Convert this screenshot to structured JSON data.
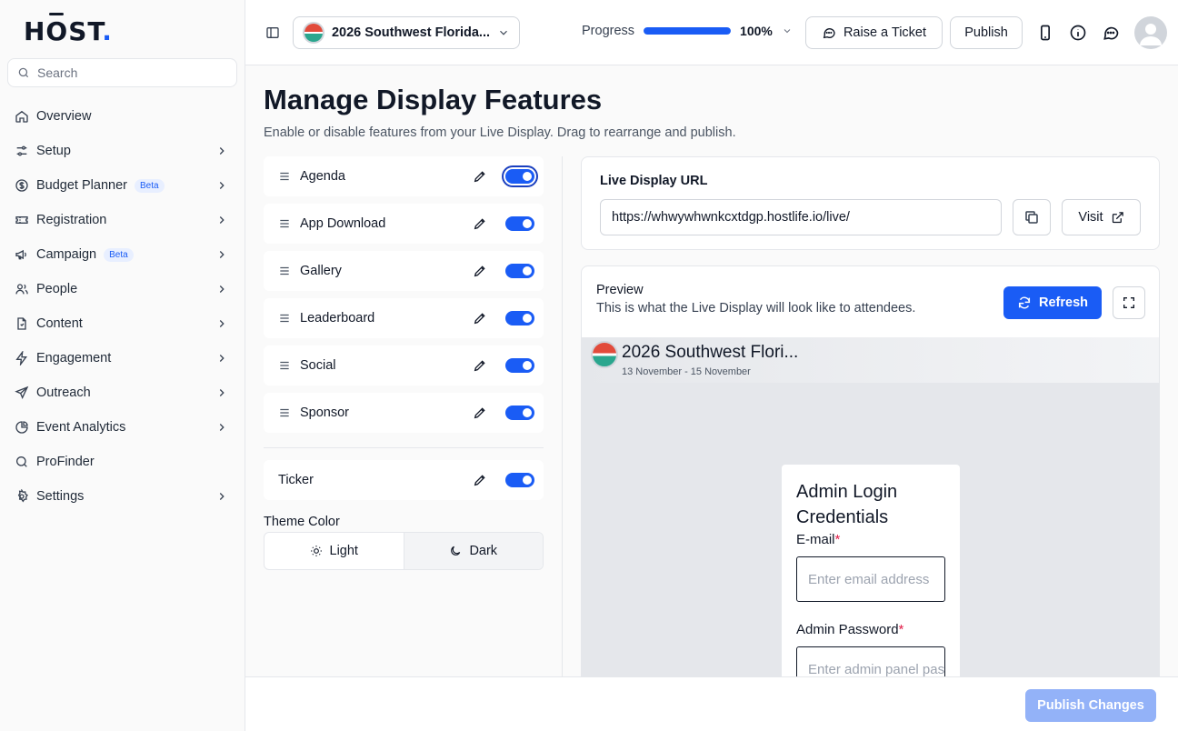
{
  "brand": {
    "logo_text": "HOST",
    "logo_dot": "."
  },
  "sidebar": {
    "search_placeholder": "Search",
    "items": [
      {
        "label": "Overview",
        "icon": "home-icon",
        "chevron": false,
        "badge": ""
      },
      {
        "label": "Setup",
        "icon": "sliders-icon",
        "chevron": true,
        "badge": ""
      },
      {
        "label": "Budget Planner",
        "icon": "dollar-icon",
        "chevron": true,
        "badge": "Beta"
      },
      {
        "label": "Registration",
        "icon": "ticket-icon",
        "chevron": true,
        "badge": ""
      },
      {
        "label": "Campaign",
        "icon": "megaphone-icon",
        "chevron": true,
        "badge": "Beta"
      },
      {
        "label": "People",
        "icon": "users-icon",
        "chevron": true,
        "badge": ""
      },
      {
        "label": "Content",
        "icon": "file-icon",
        "chevron": true,
        "badge": ""
      },
      {
        "label": "Engagement",
        "icon": "bolt-icon",
        "chevron": true,
        "badge": ""
      },
      {
        "label": "Outreach",
        "icon": "send-icon",
        "chevron": true,
        "badge": ""
      },
      {
        "label": "Event Analytics",
        "icon": "pie-chart-icon",
        "chevron": true,
        "badge": ""
      },
      {
        "label": "ProFinder",
        "icon": "search-icon",
        "chevron": false,
        "badge": ""
      },
      {
        "label": "Settings",
        "icon": "gear-icon",
        "chevron": true,
        "badge": ""
      }
    ]
  },
  "topbar": {
    "event_name": "2026 Southwest Florida...",
    "progress_label": "Progress",
    "progress_value": "100%",
    "progress_fraction": 1.0,
    "raise_ticket": "Raise a Ticket",
    "publish": "Publish"
  },
  "main": {
    "title": "Manage Display Features",
    "subtitle": "Enable or disable features from your Live Display. Drag to rearrange and publish.",
    "features": [
      "Agenda",
      "App Download",
      "Gallery",
      "Leaderboard",
      "Social",
      "Sponsor"
    ],
    "ticker": "Ticker",
    "theme_label": "Theme Color",
    "theme_light": "Light",
    "theme_dark": "Dark"
  },
  "url_card": {
    "title": "Live Display URL",
    "url": "https://whwywhwnkcxtdgp.hostlife.io/live/",
    "visit": "Visit"
  },
  "preview": {
    "title": "Preview",
    "subtitle": "This is what the Live Display will look like to attendees.",
    "refresh": "Refresh",
    "event_name": "2026 Southwest Flori...",
    "dates": "13 November - 15 November",
    "login_title": "Admin Login Credentials",
    "email_label": "E-mail",
    "email_placeholder": "Enter email address",
    "password_label": "Admin Password",
    "password_placeholder": "Enter admin panel password",
    "required_mark": "*"
  },
  "footer": {
    "publish_changes": "Publish Changes"
  },
  "colors": {
    "accent": "#1a5cf5",
    "accent_disabled": "#93b2f8"
  }
}
